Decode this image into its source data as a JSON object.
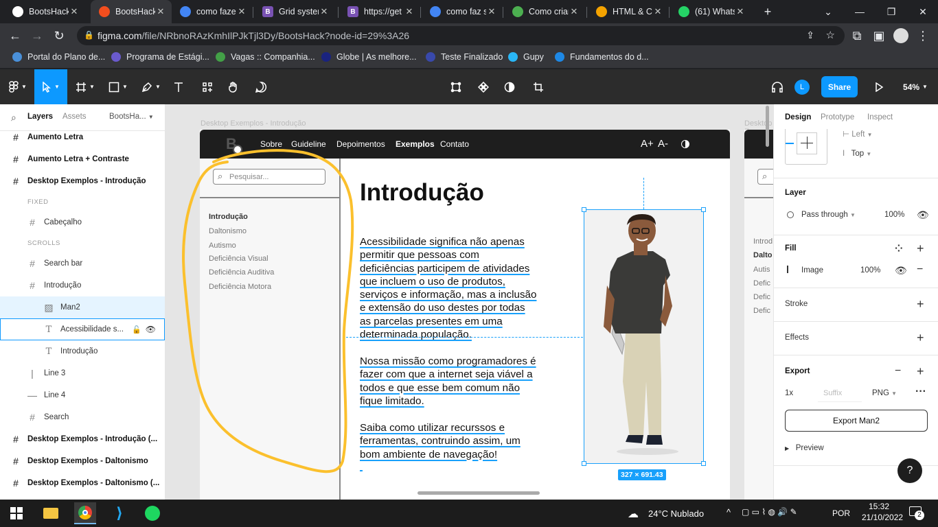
{
  "browser": {
    "tabs": [
      {
        "title": "BootsHack",
        "icon": "github-icon",
        "color": "#ffffff",
        "active": false
      },
      {
        "title": "BootsHack",
        "icon": "figma-icon",
        "color": "#f24e1e",
        "active": true
      },
      {
        "title": "como fazer",
        "icon": "google-icon",
        "color": "#4285f4",
        "active": false
      },
      {
        "title": "Grid system",
        "icon": "bootstrap-icon",
        "color": "#7952b3",
        "active": false
      },
      {
        "title": "https://get",
        "icon": "bootstrap-icon",
        "color": "#7952b3",
        "active": false
      },
      {
        "title": "como faz s",
        "icon": "google-icon",
        "color": "#4285f4",
        "active": false
      },
      {
        "title": "Como criar",
        "icon": "site-icon",
        "color": "#4caf50",
        "active": false
      },
      {
        "title": "HTML & C",
        "icon": "site-icon",
        "color": "#f4a300",
        "active": false
      },
      {
        "title": "(61) Whats",
        "icon": "whatsapp-icon",
        "color": "#25d366",
        "active": false
      }
    ],
    "url_host": "figma.com",
    "url_path": "/file/NRbnoRAzKmhIlPJkTjl3Dy/BootsHack?node-id=29%3A26",
    "bookmarks": [
      {
        "label": "Portal do Plano de...",
        "color": "#4a90d9"
      },
      {
        "label": "Programa de Estági...",
        "color": "#6a5acd"
      },
      {
        "label": "Vagas :: Companhia...",
        "color": "#43a047"
      },
      {
        "label": "Globe | As melhore...",
        "color": "#1a237e"
      },
      {
        "label": "Teste Finalizado",
        "color": "#3949ab"
      },
      {
        "label": "Gupy",
        "color": "#29b6f6"
      },
      {
        "label": "Fundamentos do d...",
        "color": "#1e88e5"
      }
    ]
  },
  "figma": {
    "toolbar": {
      "share": "Share",
      "zoom": "54%",
      "avatar": "L"
    },
    "left_panel": {
      "tabs": [
        "Layers",
        "Assets"
      ],
      "page": "BootsHa...",
      "layers": [
        {
          "name": "Aumento Letra",
          "indent": 0,
          "type": "frame",
          "bold": true
        },
        {
          "name": "Aumento Letra + Contraste",
          "indent": 0,
          "type": "frame",
          "bold": true
        },
        {
          "name": "Desktop Exemplos - Introdução",
          "indent": 0,
          "type": "frame",
          "bold": true
        },
        {
          "name": "FIXED",
          "indent": 1,
          "type": "section"
        },
        {
          "name": "Cabeçalho",
          "indent": 1,
          "type": "frame"
        },
        {
          "name": "SCROLLS",
          "indent": 1,
          "type": "section"
        },
        {
          "name": "Search bar",
          "indent": 1,
          "type": "frame"
        },
        {
          "name": "Introdução",
          "indent": 1,
          "type": "frame"
        },
        {
          "name": "Man2",
          "indent": 2,
          "type": "image",
          "selected": true
        },
        {
          "name": "Acessibilidade s...",
          "indent": 2,
          "type": "text",
          "hover": true
        },
        {
          "name": "Introdução",
          "indent": 2,
          "type": "text"
        },
        {
          "name": "Line 3",
          "indent": 1,
          "type": "vline"
        },
        {
          "name": "Line 4",
          "indent": 1,
          "type": "hline"
        },
        {
          "name": "Search",
          "indent": 1,
          "type": "frame"
        },
        {
          "name": "Desktop Exemplos - Introdução (...",
          "indent": 0,
          "type": "frame",
          "bold": true
        },
        {
          "name": "Desktop Exemplos - Daltonismo",
          "indent": 0,
          "type": "frame",
          "bold": true
        },
        {
          "name": "Desktop Exemplos - Daltonismo (...",
          "indent": 0,
          "type": "frame",
          "bold": true
        }
      ]
    },
    "canvas": {
      "frame_label": "Desktop Exemplos - Introdução",
      "frame_label_right": "Desktop Ex",
      "site": {
        "nav": [
          "Sobre",
          "Guideline",
          "Depoimentos",
          "Exemplos",
          "Contato"
        ],
        "nav_active": "Exemplos",
        "font_controls": [
          "A+",
          "A-"
        ],
        "search_placeholder": "Pesquisar...",
        "sidebar": [
          "Introdução",
          "Daltonismo",
          "Autismo",
          "Deficiência Visual",
          "Deficiência Auditiva",
          "Deficiência Motora"
        ],
        "title": "Introdução",
        "paragraphs": [
          [
            "Acessibilidade significa não apenas",
            "permitir que pessoas com",
            "deficiências participem de atividades",
            "que incluem o uso de produtos,",
            "serviços e informação, mas a inclusão",
            "e extensão do uso destes por todas",
            "as parcelas presentes em uma",
            "determinada população."
          ],
          [
            "Nossa missão como programadores é",
            "fazer com que a internet seja viável a",
            "todos e que esse bem comum não",
            "fique limitado."
          ],
          [
            "Saiba como utilizar recurssos e",
            "ferramentas, contruindo assim, um",
            "bom ambiente de navegação!"
          ]
        ],
        "right_sidebar": [
          "Introd",
          "Dalto",
          "Autis",
          "Defic",
          "Defic",
          "Defic"
        ]
      },
      "dimension_badge": "327 × 691.43"
    },
    "right_panel": {
      "tabs": [
        "Design",
        "Prototype",
        "Inspect"
      ],
      "constraints": {
        "horizontal": "Left",
        "vertical": "Top"
      },
      "layer": {
        "title": "Layer",
        "blend": "Pass through",
        "opacity": "100%"
      },
      "fill": {
        "title": "Fill",
        "type": "Image",
        "opacity": "100%"
      },
      "stroke": "Stroke",
      "effects": "Effects",
      "export": {
        "title": "Export",
        "scale": "1x",
        "suffix_placeholder": "Suffix",
        "format": "PNG",
        "button": "Export Man2",
        "preview": "Preview"
      },
      "help": "?"
    }
  },
  "taskbar": {
    "weather": "24°C  Nublado",
    "lang": "POR",
    "time": "15:32",
    "date": "21/10/2022",
    "notifications": "2"
  }
}
